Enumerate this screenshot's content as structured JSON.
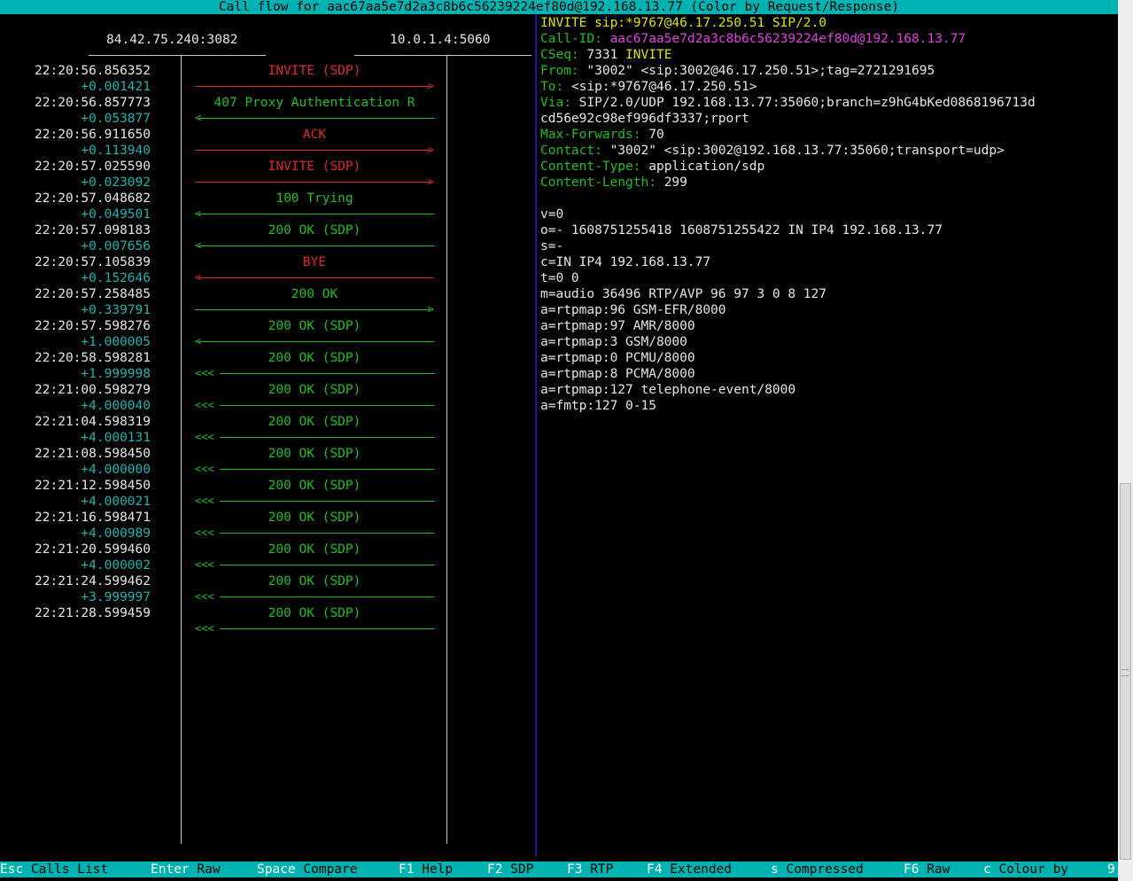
{
  "title": "Call flow for aac67aa5e7d2a3c8b6c56239224ef80d@192.168.13.77 (Color by Request/Response)",
  "hosts": [
    "84.42.75.240:3082",
    "10.0.1.4:5060"
  ],
  "messages": [
    {
      "time": "22:20:56.856352",
      "delta": "+0.001421",
      "label": "INVITE (SDP)",
      "direction": "right",
      "color": "red"
    },
    {
      "time": "22:20:56.857773",
      "delta": "+0.053877",
      "label": "407 Proxy Authentication R",
      "direction": "left",
      "color": "green"
    },
    {
      "time": "22:20:56.911650",
      "delta": "+0.113940",
      "label": "ACK",
      "direction": "right",
      "color": "red"
    },
    {
      "time": "22:20:57.025590",
      "delta": "+0.023092",
      "label": "INVITE (SDP)",
      "direction": "right",
      "color": "red"
    },
    {
      "time": "22:20:57.048682",
      "delta": "+0.049501",
      "label": "100 Trying",
      "direction": "left",
      "color": "green"
    },
    {
      "time": "22:20:57.098183",
      "delta": "+0.007656",
      "label": "200 OK (SDP)",
      "direction": "left",
      "color": "green"
    },
    {
      "time": "22:20:57.105839",
      "delta": "+0.152646",
      "label": "BYE",
      "direction": "left",
      "color": "red"
    },
    {
      "time": "22:20:57.258485",
      "delta": "+0.339791",
      "label": "200 OK",
      "direction": "right",
      "color": "green"
    },
    {
      "time": "22:20:57.598276",
      "delta": "+1.000005",
      "label": "200 OK (SDP)",
      "direction": "left",
      "color": "green"
    },
    {
      "time": "22:20:58.598281",
      "delta": "+1.999998",
      "label": "200 OK (SDP)",
      "direction": "retrans",
      "color": "green"
    },
    {
      "time": "22:21:00.598279",
      "delta": "+4.000040",
      "label": "200 OK (SDP)",
      "direction": "retrans",
      "color": "green"
    },
    {
      "time": "22:21:04.598319",
      "delta": "+4.000131",
      "label": "200 OK (SDP)",
      "direction": "retrans",
      "color": "green"
    },
    {
      "time": "22:21:08.598450",
      "delta": "+4.000000",
      "label": "200 OK (SDP)",
      "direction": "retrans",
      "color": "green"
    },
    {
      "time": "22:21:12.598450",
      "delta": "+4.000021",
      "label": "200 OK (SDP)",
      "direction": "retrans",
      "color": "green"
    },
    {
      "time": "22:21:16.598471",
      "delta": "+4.000989",
      "label": "200 OK (SDP)",
      "direction": "retrans",
      "color": "green"
    },
    {
      "time": "22:21:20.599460",
      "delta": "+4.000002",
      "label": "200 OK (SDP)",
      "direction": "retrans",
      "color": "green"
    },
    {
      "time": "22:21:24.599462",
      "delta": "+3.999997",
      "label": "200 OK (SDP)",
      "direction": "retrans",
      "color": "green"
    },
    {
      "time": "22:21:28.599459",
      "delta": "",
      "label": "200 OK (SDP)",
      "direction": "retrans",
      "color": "green"
    }
  ],
  "detail": {
    "request_line": "INVITE sip:*9767@46.17.250.51 SIP/2.0",
    "headers": [
      {
        "name": "Call-ID:",
        "value": "aac67aa5e7d2a3c8b6c56239224ef80d@192.168.13.77",
        "style": "magenta"
      },
      {
        "name": "CSeq:",
        "value": "7331",
        "method": "INVITE"
      },
      {
        "name": "From:",
        "value": "\"3002\" <sip:3002@46.17.250.51>;tag=2721291695"
      },
      {
        "name": "To:",
        "value": "<sip:*9767@46.17.250.51>"
      },
      {
        "name": "Via:",
        "value": "SIP/2.0/UDP 192.168.13.77:35060;branch=z9hG4bKed0868196713d"
      },
      {
        "name": "",
        "value": "cd56e92c98ef996df3337;rport"
      },
      {
        "name": "Max-Forwards:",
        "value": "70"
      },
      {
        "name": "Contact:",
        "value": "\"3002\" <sip:3002@192.168.13.77:35060;transport=udp>"
      },
      {
        "name": "Content-Type:",
        "value": "application/sdp"
      },
      {
        "name": "Content-Length:",
        "value": "299"
      }
    ],
    "sdp": [
      "v=0",
      "o=- 1608751255418 1608751255422 IN IP4 192.168.13.77",
      "s=-",
      "c=IN IP4 192.168.13.77",
      "t=0 0",
      "m=audio 36496 RTP/AVP 96 97 3 0 8 127",
      "a=rtpmap:96 GSM-EFR/8000",
      "a=rtpmap:97 AMR/8000",
      "a=rtpmap:3 GSM/8000",
      "a=rtpmap:0 PCMU/8000",
      "a=rtpmap:8 PCMA/8000",
      "a=rtpmap:127 telephone-event/8000",
      "a=fmtp:127 0-15"
    ]
  },
  "footer": [
    {
      "key": "Esc",
      "label": "Calls List"
    },
    {
      "key": "Enter",
      "label": "Raw"
    },
    {
      "key": "Space",
      "label": "Compare"
    },
    {
      "key": "F1",
      "label": "Help"
    },
    {
      "key": "F2",
      "label": "SDP"
    },
    {
      "key": "F3",
      "label": "RTP"
    },
    {
      "key": "F4",
      "label": "Extended"
    },
    {
      "key": "s",
      "label": "Compressed"
    },
    {
      "key": "F6",
      "label": "Raw"
    },
    {
      "key": "c",
      "label": "Colour by"
    },
    {
      "key": "9",
      "label": ""
    }
  ],
  "colors": {
    "title_bg": "#00b3b3",
    "request": "#e02828",
    "response": "#1fbf1f",
    "delta": "#19b3b3",
    "divider": "#1a1aa0"
  }
}
